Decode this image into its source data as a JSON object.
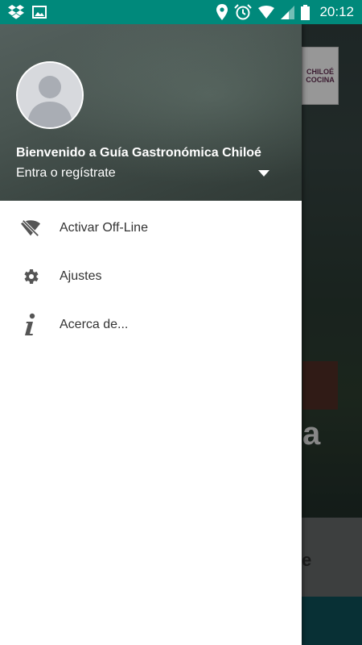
{
  "status_bar": {
    "time": "20:12",
    "left_icons": [
      "dropbox-icon",
      "image-icon"
    ],
    "right_icons": [
      "location-icon",
      "alarm-icon",
      "wifi-icon",
      "signal-icon",
      "battery-icon"
    ],
    "color": "#00897b"
  },
  "drawer": {
    "welcome_text": "Bienvenido a Guía Gastronómica Chiloé",
    "account_label": "Entra o regístrate",
    "menu": [
      {
        "label": "Activar Off-Line",
        "icon": "wifi-off-icon"
      },
      {
        "label": "Ajustes",
        "icon": "gear-icon"
      },
      {
        "label": "Acerca de...",
        "icon": "info-icon"
      }
    ]
  },
  "background_app": {
    "logo_text": "CHILOÉ COCINA",
    "partial_text": "a",
    "card_text": "e"
  }
}
